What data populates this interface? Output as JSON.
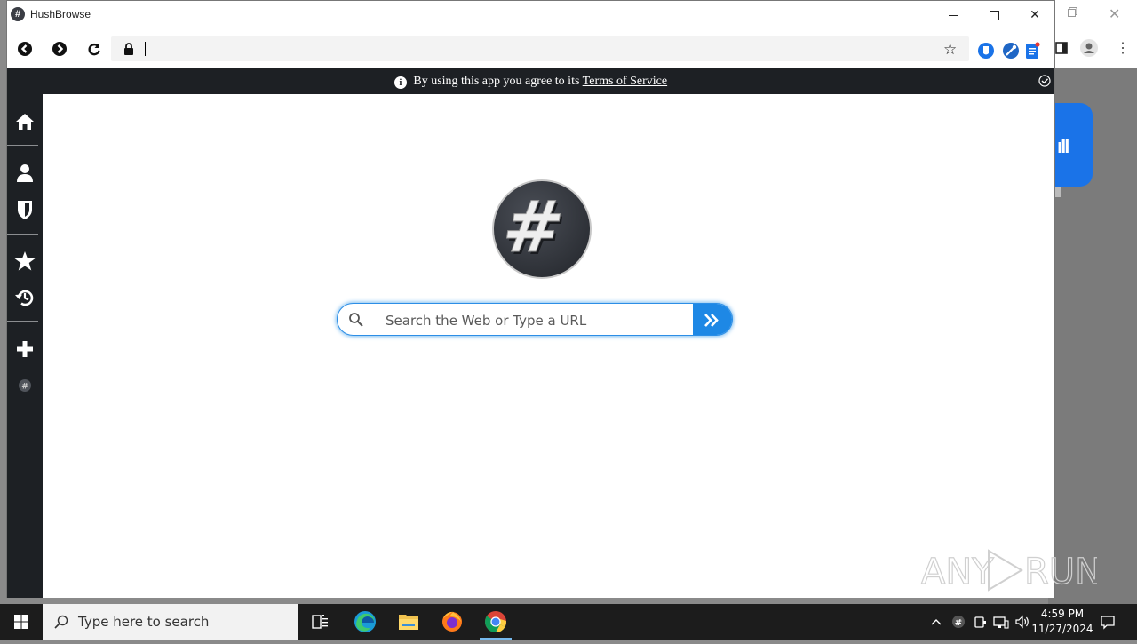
{
  "window": {
    "title": "HushBrowse",
    "logo_glyph": "#"
  },
  "address_bar": {
    "value": "",
    "placeholder": ""
  },
  "notice": {
    "text": "By using this app you agree to its",
    "link": "Terms of Service",
    "info_glyph": "i"
  },
  "search": {
    "placeholder": "Search the Web or Type a URL"
  },
  "sidebar": {
    "items": [
      {
        "icon": "home-icon"
      },
      {
        "icon": "user-icon"
      },
      {
        "icon": "shield-icon"
      },
      {
        "icon": "star-icon"
      },
      {
        "icon": "history-icon"
      },
      {
        "icon": "plus-icon"
      },
      {
        "icon": "hush-logo-icon"
      }
    ]
  },
  "taskbar": {
    "search_placeholder": "Type here to search",
    "time": "4:59 PM",
    "date": "11/27/2024"
  },
  "watermark": "ANY RUN",
  "colors": {
    "accent": "#1e88e5",
    "dark": "#1d2024",
    "brand_circle": "#3a3d44"
  }
}
